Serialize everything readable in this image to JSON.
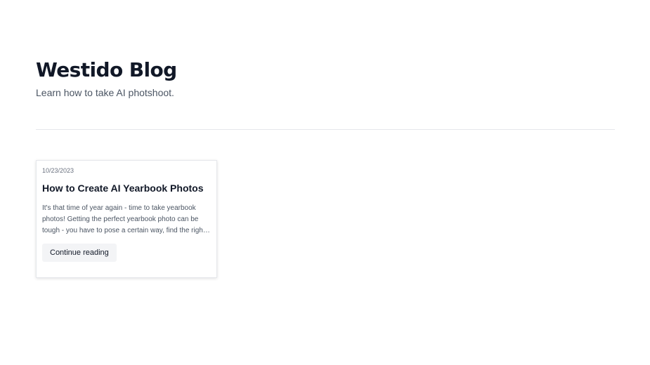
{
  "header": {
    "title": "Westido Blog",
    "subtitle": "Learn how to take AI photshoot."
  },
  "posts": [
    {
      "date": "10/23/2023",
      "title": "How to Create AI Yearbook Photos",
      "excerpt": "It's that time of year again - time to take yearbook photos! Getting the perfect yearbook photo can be tough - you have to pose a certain way, find the right lighting, and hope that everything turns out well.",
      "button_label": "Continue reading"
    }
  ]
}
